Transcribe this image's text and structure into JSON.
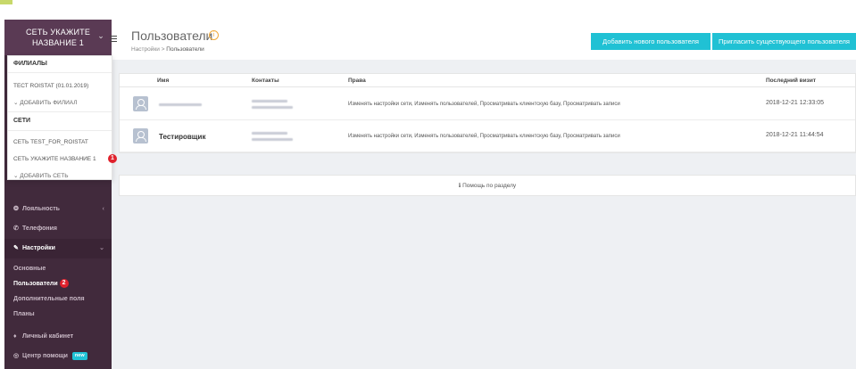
{
  "sidebar": {
    "network_button": [
      "СЕТЬ УКАЖИТЕ",
      "НАЗВАНИЕ 1"
    ],
    "dropdown": {
      "branches_header": "ФИЛИАЛЫ",
      "branches": [
        "ТЕСТ ROISTAT (01.01.2019)"
      ],
      "add_branch": "ДОБАВИТЬ ФИЛИАЛ",
      "networks_header": "СЕТИ",
      "networks": [
        "СЕТЬ TEST_FOR_ROISTAT",
        "СЕТЬ УКАЖИТЕ НАЗВАНИЕ 1"
      ],
      "add_network": "ДОБАВИТЬ СЕТЬ",
      "badge": "1"
    },
    "menu": {
      "loyalty": "Лояльность",
      "telephony": "Телефония",
      "settings": "Настройки",
      "settings_sub": [
        "Основные",
        "Пользователи",
        "Дополнительные поля",
        "Планы"
      ],
      "users_badge": "2",
      "account": "Личный кабинет",
      "help_center": "Центр помощи",
      "new_badge": "new"
    }
  },
  "header": {
    "title": "Пользователи",
    "breadcrumb_root": "Настройки",
    "breadcrumb_sep": ">",
    "breadcrumb_current": "Пользователи",
    "add_user_button": "Добавить нового пользователя",
    "invite_user_button": "Пригласить существующего пользователя"
  },
  "table": {
    "columns": [
      "Имя",
      "Контакты",
      "Права",
      "Последний визит"
    ],
    "rows": [
      {
        "name": "",
        "rights": "Изменять настройки сети, Изменять пользователей, Просматривать клиентскую базу, Просматривать записи",
        "last_visit": "2018-12-21 12:33:05"
      },
      {
        "name": "Тестировщик",
        "rights": "Изменять настройки сети, Изменять пользователей, Просматривать клиентскую базу, Просматривать записи",
        "last_visit": "2018-12-21 11:44:54"
      }
    ]
  },
  "help": {
    "label": "Помощь по разделу",
    "icon": "ℹ"
  },
  "icons": {
    "info": "ⓘ",
    "hamburger": "≡",
    "chevron": "⌄"
  },
  "colors": {
    "sidebar": "#412a3c",
    "accent": "#20c1d4",
    "badge": "#e0212c",
    "warning": "#f0a93a"
  }
}
